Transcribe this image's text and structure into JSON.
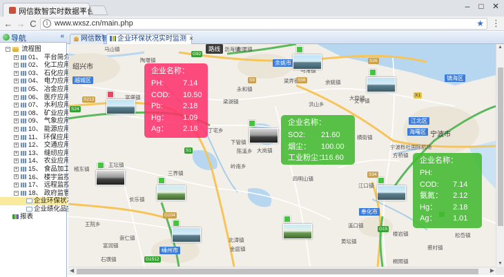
{
  "browser": {
    "tab_title": "网信数智实时数据平台",
    "tab_close": "×",
    "url": "www.wxsz.cn/main.php",
    "min": "–",
    "max": "□",
    "close": "✕",
    "back": "←",
    "forward": "→",
    "reload": "C",
    "info": "i",
    "star": "★",
    "menu": "⋮"
  },
  "nav": {
    "title": "导航",
    "collapse": "«",
    "root_label": "流程图",
    "items": [
      {
        "label": "01、  平台简介",
        "pm": "+"
      },
      {
        "label": "02、  化工应用",
        "pm": "+"
      },
      {
        "label": "03、  石化应用",
        "pm": "+"
      },
      {
        "label": "04、  电力应用",
        "pm": "+"
      },
      {
        "label": "05、  冶金应用",
        "pm": "+"
      },
      {
        "label": "06、  医疗应用",
        "pm": "+"
      },
      {
        "label": "07、  水利应用",
        "pm": "+"
      },
      {
        "label": "08、  矿业应用",
        "pm": "+"
      },
      {
        "label": "09、  气象应用",
        "pm": "+"
      },
      {
        "label": "10、  能源应用",
        "pm": "+"
      },
      {
        "label": "11、  环保应用",
        "pm": "+"
      },
      {
        "label": "12、  交通应用",
        "pm": "+"
      },
      {
        "label": "13、  缝纫应用",
        "pm": "+"
      },
      {
        "label": "14、  农业应用",
        "pm": "+"
      },
      {
        "label": "15、  食品加工",
        "pm": "+"
      },
      {
        "label": "16、  楼宇监控",
        "pm": "+"
      },
      {
        "label": "17、  远程监控",
        "pm": "+"
      },
      {
        "label": "18、  政府监管",
        "pm": "−"
      }
    ],
    "sub_items": [
      "企业环保状况实",
      "企业绩化品实时"
    ],
    "report_label": "报表"
  },
  "content_tabs": [
    {
      "label": "网信数智",
      "closable": false
    },
    {
      "label": "企业环保状况实时监测",
      "closable": true,
      "close": "×"
    }
  ],
  "map": {
    "places": [
      {
        "name": "马山镇"
      },
      {
        "name": "陶堰镇"
      },
      {
        "name": "沥海镇"
      },
      {
        "name": "崧厦镇"
      },
      {
        "name": "绍兴市",
        "big": true
      },
      {
        "name": "越城区"
      },
      {
        "name": "富盛镇"
      },
      {
        "name": "永和镇"
      },
      {
        "name": "梁湖镇"
      },
      {
        "name": "丁宅乡"
      },
      {
        "name": "下管镇"
      },
      {
        "name": "陈溪乡"
      },
      {
        "name": "岭南乡"
      },
      {
        "name": "大岚镇"
      },
      {
        "name": "王坛镇"
      },
      {
        "name": "稽东镇"
      },
      {
        "name": "三界镇"
      },
      {
        "name": "长乐镇"
      },
      {
        "name": "嵊州市"
      },
      {
        "name": "王院乡"
      },
      {
        "name": "富润镇"
      },
      {
        "name": "崇仁镇"
      },
      {
        "name": "石璜镇"
      },
      {
        "name": "北漳镇"
      },
      {
        "name": "金庭镇"
      },
      {
        "name": "余姚市"
      },
      {
        "name": "梁弄镇"
      },
      {
        "name": "洪山乡"
      },
      {
        "name": "大隐镇"
      },
      {
        "name": "余姚镇"
      },
      {
        "name": "横街镇"
      },
      {
        "name": "宁波市",
        "big": true
      },
      {
        "name": "江北区"
      },
      {
        "name": "海曙区"
      },
      {
        "name": "镇海区"
      },
      {
        "name": "江口镇"
      },
      {
        "name": "奉化市"
      },
      {
        "name": "溪口镇"
      },
      {
        "name": "宁波栎社国际机场"
      },
      {
        "name": "方桥镇"
      },
      {
        "name": "松岙镇"
      },
      {
        "name": "楼岩镇"
      },
      {
        "name": "裘村镇"
      },
      {
        "name": "桐照镇"
      },
      {
        "name": "丈亭镇"
      },
      {
        "name": "马渚镇"
      },
      {
        "name": "四明山镇"
      },
      {
        "name": "黄坛镇"
      }
    ],
    "badge_label": "路线",
    "roads": [
      "G92",
      "S9",
      "S56",
      "S24",
      "S213",
      "G104",
      "S1",
      "G15",
      "S34",
      "G1512",
      "S26",
      "X1"
    ]
  },
  "popup_red": {
    "title": "企业名称：",
    "rows": [
      {
        "label": "PH:",
        "value": "7.14"
      },
      {
        "label": "COD:",
        "value": "10.50"
      },
      {
        "label": "Pb:",
        "value": "2.18"
      },
      {
        "label": "Hg：",
        "value": "1.09"
      },
      {
        "label": "Ag：",
        "value": "2.18"
      }
    ]
  },
  "popup_green_mid": {
    "title": "企业名称：",
    "rows": [
      {
        "label": "SO2:",
        "value": "21.60"
      },
      {
        "label": "烟尘：",
        "value": "100.00"
      },
      {
        "label": "工业粉尘：",
        "value": "116.60"
      }
    ]
  },
  "popup_green_right": {
    "title": "企业名称：",
    "rows": [
      {
        "label": "PH:",
        "value": ""
      },
      {
        "label": "COD:",
        "value": "7.14"
      },
      {
        "label": "氨氮：",
        "value": "2.12"
      },
      {
        "label": "Hg：",
        "value": "2.18"
      },
      {
        "label": "Ag：",
        "value": "1.01"
      }
    ]
  },
  "colors": {
    "popup_red": "#ff2d69",
    "popup_green": "#42b930",
    "marker_green": "#45c53f",
    "marker_red": "#e8485f",
    "road_green": "#38a035",
    "road_yellow": "#f6c55a",
    "district_blue": "#3b7dd8"
  }
}
